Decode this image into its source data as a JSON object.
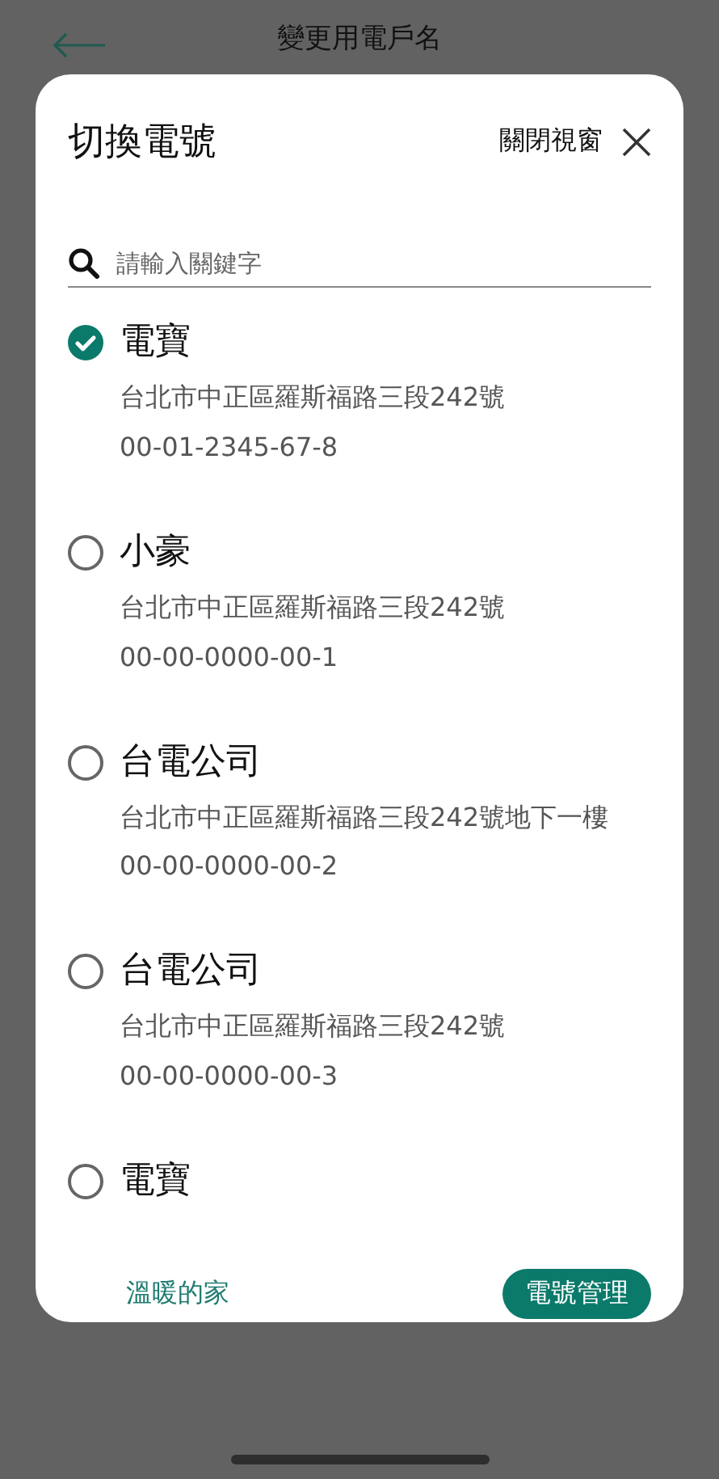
{
  "header": {
    "title": "變更用電戶名"
  },
  "sheet": {
    "title": "切換電號",
    "close_label": "關閉視窗"
  },
  "search": {
    "placeholder": "請輸入關鍵字"
  },
  "accounts": [
    {
      "name": "電寶",
      "address": "台北市中正區羅斯福路三段242號",
      "number": "00-01-2345-67-8",
      "selected": true
    },
    {
      "name": "小豪",
      "address": "台北市中正區羅斯福路三段242號",
      "number": "00-00-0000-00-1",
      "selected": false
    },
    {
      "name": "台電公司",
      "address": "台北市中正區羅斯福路三段242號地下一樓",
      "number": "00-00-0000-00-2",
      "selected": false
    },
    {
      "name": "台電公司",
      "address": "台北市中正區羅斯福路三段242號",
      "number": "00-00-0000-00-3",
      "selected": false
    },
    {
      "name": "電寶",
      "selected": false
    }
  ],
  "footer": {
    "link": "溫暖的家",
    "button": "電號管理"
  }
}
